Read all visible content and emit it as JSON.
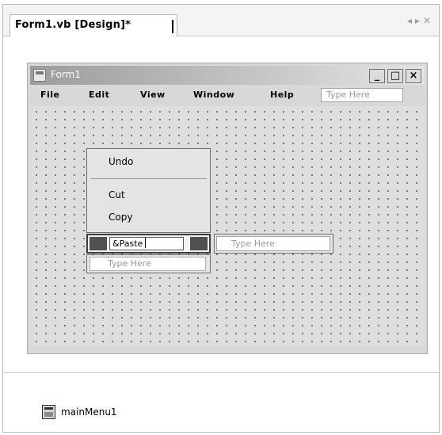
{
  "document_tab": {
    "label": "Form1.vb [Design]*"
  },
  "tab_nav": {
    "left_arrow": "◂",
    "right_arrow": "▸",
    "close": "✕"
  },
  "form": {
    "title": "Form1",
    "window_buttons": {
      "minimize": "_",
      "maximize": "□",
      "close": "×"
    }
  },
  "menu_bar": {
    "items": [
      {
        "label": "File"
      },
      {
        "label": "Edit"
      },
      {
        "label": "View"
      },
      {
        "label": "Window"
      },
      {
        "label": "Help"
      }
    ],
    "type_here": "Type Here"
  },
  "edit_menu": {
    "items": [
      {
        "label": "Undo"
      },
      {
        "label": "Cut"
      },
      {
        "label": "Copy"
      }
    ],
    "editing_item": "&Paste",
    "side_type_here": "Type Here",
    "bottom_type_here": "Type Here"
  },
  "component_tray": {
    "items": [
      {
        "label": "mainMenu1",
        "icon": "menu-component-icon"
      }
    ]
  }
}
